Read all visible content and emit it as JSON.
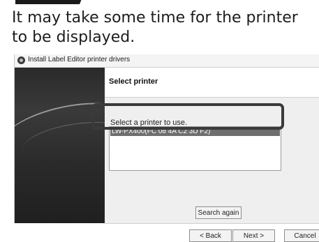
{
  "instruction": {
    "text": "It may take some time for the printer to be displayed."
  },
  "window": {
    "title": "Install Label Editor printer drivers",
    "app_icon": "installer-icon"
  },
  "page": {
    "heading": "Select printer",
    "prompt": "Select a printer to use."
  },
  "printer_list": {
    "items": [
      "LW-PX400(FC 08 4A C2 3D F2)"
    ],
    "selected_index": 0
  },
  "buttons": {
    "search_again": "Search again",
    "back": "< Back",
    "next": "Next >",
    "cancel": "Cancel"
  },
  "colors": {
    "selection": "#6e6e6e",
    "highlight_frame": "#3a3a3a",
    "side_panel": "#2b2b2b"
  }
}
